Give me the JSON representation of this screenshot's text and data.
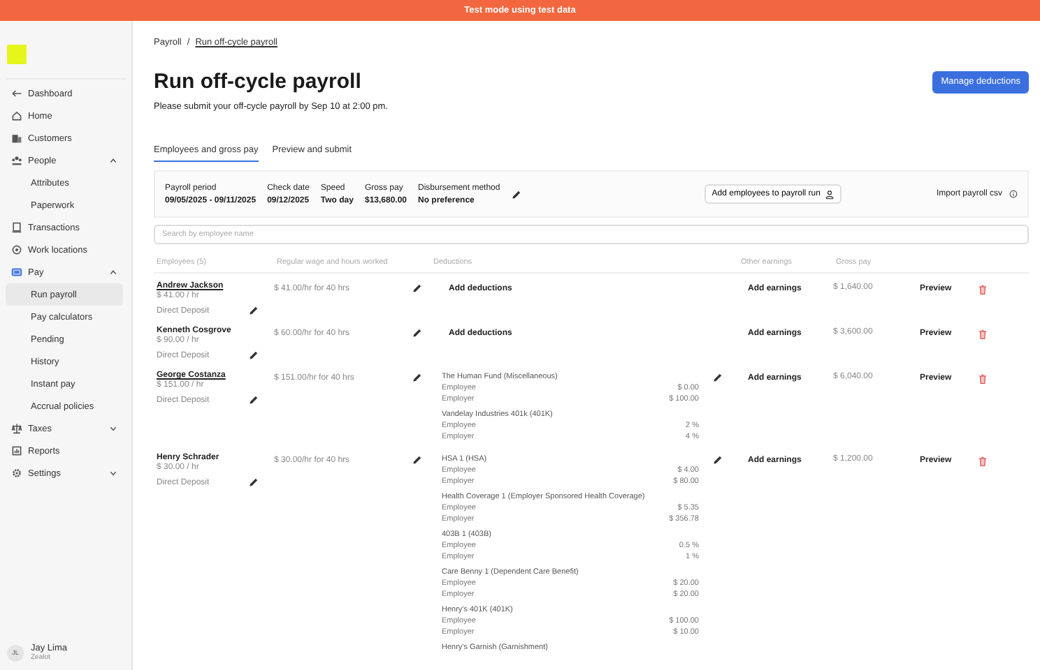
{
  "banner": {
    "text": "Test mode using test data"
  },
  "sidebar": {
    "items": [
      {
        "label": "Dashboard",
        "kind": "back",
        "selected": false
      },
      {
        "label": "Home",
        "kind": "nav",
        "selected": false
      },
      {
        "label": "Customers",
        "kind": "nav",
        "selected": false
      },
      {
        "label": "People",
        "kind": "nav",
        "expanded": true,
        "selected": false
      },
      {
        "label": "Attributes",
        "kind": "sub",
        "selected": false
      },
      {
        "label": "Paperwork",
        "kind": "sub",
        "selected": false
      },
      {
        "label": "Transactions",
        "kind": "nav",
        "selected": false
      },
      {
        "label": "Work locations",
        "kind": "nav",
        "selected": false
      },
      {
        "label": "Pay",
        "kind": "nav",
        "expanded": true,
        "selected": false
      },
      {
        "label": "Run payroll",
        "kind": "sub",
        "selected": true
      },
      {
        "label": "Pay calculators",
        "kind": "sub",
        "selected": false
      },
      {
        "label": "Pending",
        "kind": "sub",
        "selected": false
      },
      {
        "label": "History",
        "kind": "sub",
        "selected": false
      },
      {
        "label": "Instant pay",
        "kind": "sub",
        "selected": false
      },
      {
        "label": "Accrual policies",
        "kind": "sub",
        "selected": false
      },
      {
        "label": "Taxes",
        "kind": "nav",
        "expanded": false,
        "selected": false
      },
      {
        "label": "Reports",
        "kind": "nav",
        "selected": false
      },
      {
        "label": "Settings",
        "kind": "nav",
        "expanded": false,
        "selected": false
      }
    ],
    "user": {
      "initials": "JL",
      "name": "Jay Lima",
      "org": "Zealot"
    }
  },
  "breadcrumb": {
    "items": [
      "Payroll",
      "Run off-cycle payroll"
    ],
    "separator": "/"
  },
  "title": "Run off-cycle payroll",
  "subtitle": "Please submit your off-cycle payroll by Sep 10 at 2:00 pm.",
  "manage_button": "Manage deductions",
  "tabs": [
    {
      "label": "Employees and gross pay",
      "selected": true
    },
    {
      "label": "Preview and submit",
      "selected": false
    }
  ],
  "summary": {
    "fields": [
      {
        "label": "Payroll period",
        "value": "09/05/2025 - 09/11/2025"
      },
      {
        "label": "Check date",
        "value": "09/12/2025"
      },
      {
        "label": "Speed",
        "value": "Two day"
      },
      {
        "label": "Gross pay",
        "value": "$13,680.00"
      },
      {
        "label": "Disbursement method",
        "value": "No preference"
      }
    ],
    "add_employees_button": "Add employees to payroll run",
    "import_button": "Import payroll csv"
  },
  "search": {
    "placeholder": "Search by employee name"
  },
  "table": {
    "columns": [
      "Employees (5)",
      "Regular wage and hours worked",
      "Deductions",
      "Other earnings",
      "Gross pay"
    ],
    "rows": [
      {
        "name": "Andrew Jackson",
        "linked": true,
        "rate": "$ 41.00 / hr",
        "payment_method": "Direct Deposit",
        "wage": "$ 41.00/hr for 40 hrs",
        "add_deductions": "Add deductions",
        "other_earnings": "Add earnings",
        "gross": "$ 1,640.00",
        "preview": "Preview"
      },
      {
        "name": "Kenneth Cosgrove",
        "linked": false,
        "rate": "$ 90.00 / hr",
        "payment_method": "Direct Deposit",
        "wage": "$ 60.00/hr for 40 hrs",
        "add_deductions": "Add deductions",
        "other_earnings": "Add earnings",
        "gross": "$ 3,600.00",
        "preview": "Preview"
      },
      {
        "name": "George Costanza",
        "linked": true,
        "rate": "$ 151.00 / hr",
        "payment_method": "Direct Deposit",
        "wage": "$ 151.00/hr for 40 hrs",
        "deductions": [
          {
            "name": "The Human Fund (Miscellaneous)",
            "lines": [
              {
                "label": "Employee",
                "amount": "$ 0.00"
              },
              {
                "label": "Employer",
                "amount": "$ 100.00"
              }
            ]
          },
          {
            "name": "Vandelay Industries 401k (401K)",
            "lines": [
              {
                "label": "Employee",
                "amount": "2 %"
              },
              {
                "label": "Employer",
                "amount": "4 %"
              }
            ]
          }
        ],
        "other_earnings": "Add earnings",
        "gross": "$ 6,040.00",
        "preview": "Preview"
      },
      {
        "name": "Henry Schrader",
        "linked": false,
        "rate": "$ 30.00 / hr",
        "payment_method": "Direct Deposit",
        "wage": "$ 30.00/hr for 40 hrs",
        "deductions": [
          {
            "name": "HSA 1 (HSA)",
            "lines": [
              {
                "label": "Employee",
                "amount": "$ 4.00"
              },
              {
                "label": "Employer",
                "amount": "$ 80.00"
              }
            ]
          },
          {
            "name": "Health Coverage 1 (Employer Sponsored Health Coverage)",
            "lines": [
              {
                "label": "Employee",
                "amount": "$ 5.35"
              },
              {
                "label": "Employer",
                "amount": "$ 356.78"
              }
            ]
          },
          {
            "name": "403B 1 (403B)",
            "lines": [
              {
                "label": "Employee",
                "amount": "0.5 %"
              },
              {
                "label": "Employer",
                "amount": "1 %"
              }
            ]
          },
          {
            "name": "Care Benny 1 (Dependent Care Benefit)",
            "lines": [
              {
                "label": "Employee",
                "amount": "$ 20.00"
              },
              {
                "label": "Employer",
                "amount": "$ 20.00"
              }
            ]
          },
          {
            "name": "Henry's 401K (401K)",
            "lines": [
              {
                "label": "Employee",
                "amount": "$ 100.00"
              },
              {
                "label": "Employer",
                "amount": "$ 10.00"
              }
            ]
          },
          {
            "name": "Henry's Garnish (Garnishment)"
          }
        ],
        "other_earnings": "Add earnings",
        "gross": "$ 1,200.00",
        "preview": "Preview"
      }
    ]
  }
}
